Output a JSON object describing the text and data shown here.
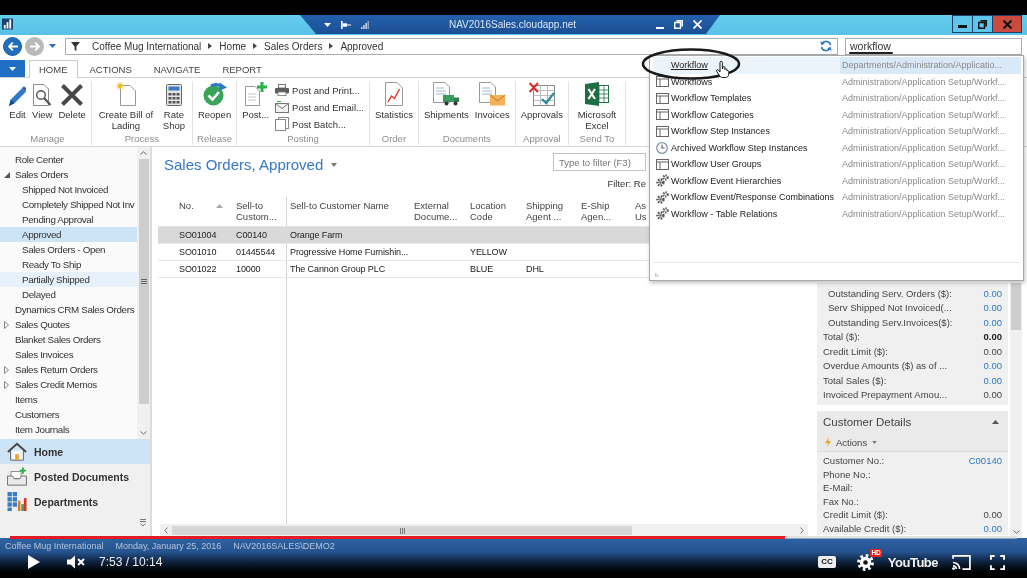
{
  "window": {
    "remote_bar": {
      "host": "NAV2016Sales.cloudapp.net"
    }
  },
  "address_bar": {
    "breadcrumbs": [
      "Coffee Mug International",
      "Home",
      "Sales Orders",
      "Approved"
    ],
    "search": {
      "value": "workflow"
    }
  },
  "ribbon": {
    "tabs": [
      {
        "label": "HOME",
        "selected": true
      },
      {
        "label": "ACTIONS",
        "selected": false
      },
      {
        "label": "NAVIGATE",
        "selected": false
      },
      {
        "label": "REPORT",
        "selected": false
      }
    ],
    "groups": [
      {
        "name": "Manage",
        "items": [
          {
            "kind": "large",
            "label": "Edit"
          },
          {
            "kind": "large",
            "label": "View"
          },
          {
            "kind": "large",
            "label": "Delete"
          }
        ]
      },
      {
        "name": "Process",
        "items": [
          {
            "kind": "large",
            "label": "Create Bill of Lading"
          },
          {
            "kind": "large",
            "label": "Rate Shop"
          }
        ]
      },
      {
        "name": "Release",
        "items": [
          {
            "kind": "large",
            "label": "Reopen"
          }
        ]
      },
      {
        "name": "Posting",
        "items": [
          {
            "kind": "large",
            "label": "Post..."
          },
          {
            "kind": "small",
            "label": "Post and Print..."
          },
          {
            "kind": "small",
            "label": "Post and Email..."
          },
          {
            "kind": "small",
            "label": "Post Batch..."
          }
        ]
      },
      {
        "name": "Order",
        "items": [
          {
            "kind": "large",
            "label": "Statistics"
          }
        ]
      },
      {
        "name": "Documents",
        "items": [
          {
            "kind": "large",
            "label": "Shipments"
          },
          {
            "kind": "large",
            "label": "Invoices"
          }
        ]
      },
      {
        "name": "Approval",
        "items": [
          {
            "kind": "large",
            "label": "Approvals"
          }
        ]
      },
      {
        "name": "Send To",
        "items": [
          {
            "kind": "large",
            "label": "Microsoft Excel"
          }
        ]
      }
    ]
  },
  "navigation": {
    "tree": [
      {
        "label": "Role Center",
        "selected": false,
        "hovered": false
      },
      {
        "label": "Sales Orders",
        "expanded": true,
        "selected": false,
        "hovered": false,
        "children": [
          {
            "label": "Shipped Not Invoiced",
            "selected": false,
            "hovered": false
          },
          {
            "label": "Completely Shipped Not Inv",
            "selected": false,
            "hovered": false
          },
          {
            "label": "Pending Approval",
            "selected": false,
            "hovered": false
          },
          {
            "label": "Approved",
            "selected": true,
            "hovered": false
          },
          {
            "label": "Sales Orders - Open",
            "selected": false,
            "hovered": false
          },
          {
            "label": "Ready To Ship",
            "selected": false,
            "hovered": false
          },
          {
            "label": "Partially Shipped",
            "selected": false,
            "hovered": true
          },
          {
            "label": "Delayed",
            "selected": false,
            "hovered": false
          }
        ]
      },
      {
        "label": "Dynamics CRM Sales Orders",
        "selected": false,
        "hovered": false
      },
      {
        "label": "Sales Quotes",
        "expanded": false,
        "selected": false,
        "hovered": false
      },
      {
        "label": "Blanket Sales Orders",
        "selected": false,
        "hovered": false
      },
      {
        "label": "Sales Invoices",
        "selected": false,
        "hovered": false
      },
      {
        "label": "Sales Return Orders",
        "expanded": false,
        "selected": false,
        "hovered": false
      },
      {
        "label": "Sales Credit Memos",
        "expanded": false,
        "selected": false,
        "hovered": false
      },
      {
        "label": "Items",
        "selected": false,
        "hovered": false
      },
      {
        "label": "Customers",
        "selected": false,
        "hovered": false
      },
      {
        "label": "Item Journals",
        "selected": false,
        "hovered": false
      }
    ],
    "buttons": [
      {
        "label": "Home",
        "selected": true
      },
      {
        "label": "Posted Documents",
        "selected": false
      },
      {
        "label": "Departments",
        "selected": false
      }
    ]
  },
  "page": {
    "title": "Sales Orders, Approved",
    "filter": {
      "placeholder": "Type to filter (F3)"
    },
    "filter_summary": "Filter: Re",
    "columns": [
      {
        "label": "No.",
        "sorted": true
      },
      {
        "label": "Sell-to Custom...",
        "sorted": false
      },
      {
        "label": "Sell-to Customer Name",
        "sorted": false
      },
      {
        "label": "External Docume...",
        "sorted": false
      },
      {
        "label": "Location Code",
        "sorted": false
      },
      {
        "label": "Shipping Agent ...",
        "sorted": false
      },
      {
        "label": "E-Ship Agen...",
        "sorted": false
      },
      {
        "label": "As Us",
        "sorted": false
      }
    ],
    "rows": [
      {
        "selected": true,
        "no": "SO01004",
        "customer_no": "C00140",
        "customer_name": "Orange Farm"
      },
      {
        "selected": false,
        "no": "SO01010",
        "customer_no": "01445544",
        "customer_name": "Progressive Home Furnishin...",
        "location_code": "YELLOW"
      },
      {
        "selected": false,
        "no": "SO01022",
        "customer_no": "10000",
        "customer_name": "The Cannon Group PLC",
        "location_code": "BLUE",
        "shipping_agent": "DHL"
      }
    ]
  },
  "factbox": {
    "rows": [
      {
        "kind": "link",
        "indented": true,
        "label": "Outstanding Serv. Orders ($):",
        "value": "0.00"
      },
      {
        "kind": "link",
        "indented": true,
        "label": "Serv Shipped Not Invoiced(...",
        "value": "0.00"
      },
      {
        "kind": "link",
        "indented": true,
        "label": "Outstanding Serv.Invoices($):",
        "value": "0.00"
      },
      {
        "kind": "total",
        "indented": false,
        "label": "Total ($):",
        "value": "0.00"
      },
      {
        "kind": "plain",
        "indented": false,
        "label": "Credit Limit ($):",
        "value": "0.00"
      },
      {
        "kind": "link",
        "indented": false,
        "label": "Overdue Amounts ($) as of ...",
        "value": "0.00"
      },
      {
        "kind": "link",
        "indented": false,
        "label": "Total Sales ($):",
        "value": "0.00"
      },
      {
        "kind": "plain",
        "indented": false,
        "label": "Invoiced Prepayment Amou...",
        "value": "0.00"
      }
    ]
  },
  "customer_details": {
    "title": "Customer Details",
    "expanded": true,
    "actions": "Actions",
    "rows": [
      {
        "kind": "link",
        "label": "Customer No.:",
        "value": "C00140"
      },
      {
        "label": "Phone No.:"
      },
      {
        "label": "E-Mail:"
      },
      {
        "label": "Fax No.:"
      },
      {
        "kind": "plain",
        "label": "Credit Limit ($):",
        "value": "0.00"
      },
      {
        "kind": "link",
        "label": "Available Credit ($):",
        "value": "0.00"
      }
    ]
  },
  "search_results": {
    "items": [
      {
        "kind": "department",
        "name": "Workflow",
        "path": "Departments/Administration/Applicatio...",
        "selected": true
      },
      {
        "kind": "list",
        "name": "Workflows",
        "path": "Administration/Application Setup/Workf...",
        "selected": false
      },
      {
        "kind": "list",
        "name": "Workflow Templates",
        "path": "Administration/Application Setup/Workf...",
        "selected": false
      },
      {
        "kind": "list",
        "name": "Workflow Categories",
        "path": "Administration/Application Setup/Workf...",
        "selected": false
      },
      {
        "kind": "list",
        "name": "Workflow Step Instances",
        "path": "Administration/Application Setup/Workf...",
        "selected": false
      },
      {
        "kind": "archive",
        "name": "Archived Workflow Step Instances",
        "path": "Administration/Application Setup/Workf...",
        "selected": false
      },
      {
        "kind": "list",
        "name": "Workflow User Groups",
        "path": "Administration/Application Setup/Workf...",
        "selected": false
      },
      {
        "kind": "task",
        "name": "Workflow Event Hierarchies",
        "path": "Administration/Application Setup/Workf...",
        "selected": false
      },
      {
        "kind": "task",
        "name": "Workflow Event/Response Combinations",
        "path": "Administration/Application Setup/Workf...",
        "selected": false
      },
      {
        "kind": "task",
        "name": "Workflow - Table Relations",
        "path": "Administration/Application Setup/Workf...",
        "selected": false
      }
    ]
  },
  "status_bar": {
    "company": "Coffee Mug International",
    "date": "Monday, January 25, 2016",
    "user": "NAV2016SALES\\DEMO2"
  },
  "video_player": {
    "progress": {
      "level": 0.77
    },
    "playing": false,
    "muted": true,
    "time": "7:53 / 10:14",
    "captions": "CC",
    "quality": "HD",
    "logo": "YouTube"
  }
}
